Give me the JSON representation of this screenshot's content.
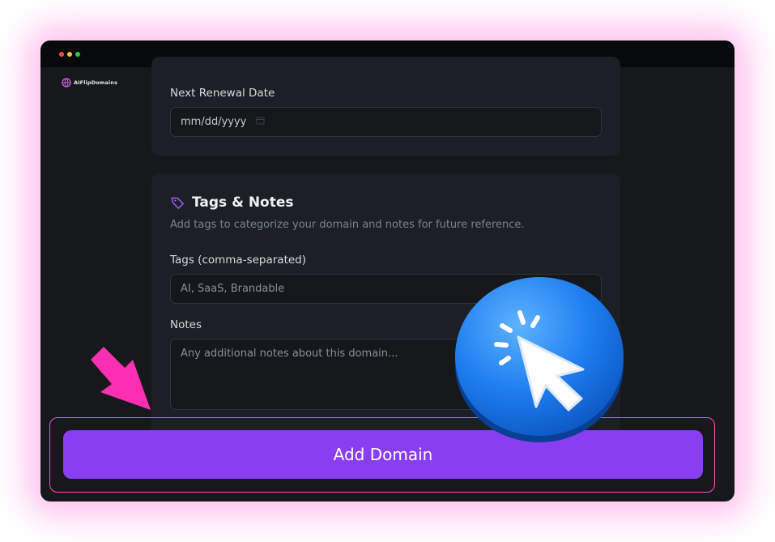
{
  "app": {
    "logo_text": "AIFlipDomains"
  },
  "renewal": {
    "label": "Next Renewal Date",
    "placeholder": "mm/dd/yyyy"
  },
  "tags_notes": {
    "title": "Tags & Notes",
    "description": "Add tags to categorize your domain and notes for future reference.",
    "tags_label": "Tags (comma-separated)",
    "tags_placeholder": "AI, SaaS, Brandable",
    "notes_label": "Notes",
    "notes_placeholder": "Any additional notes about this domain..."
  },
  "actions": {
    "add_domain_label": "Add Domain"
  },
  "colors": {
    "accent": "#8a3ef1",
    "highlight": "#ff49c8",
    "badge_blue": "#1f7ff0"
  },
  "icons": {
    "section": "tag-icon",
    "date": "calendar-icon",
    "callout_arrow": "arrow-down-right-icon",
    "callout_badge": "cursor-click-icon"
  }
}
